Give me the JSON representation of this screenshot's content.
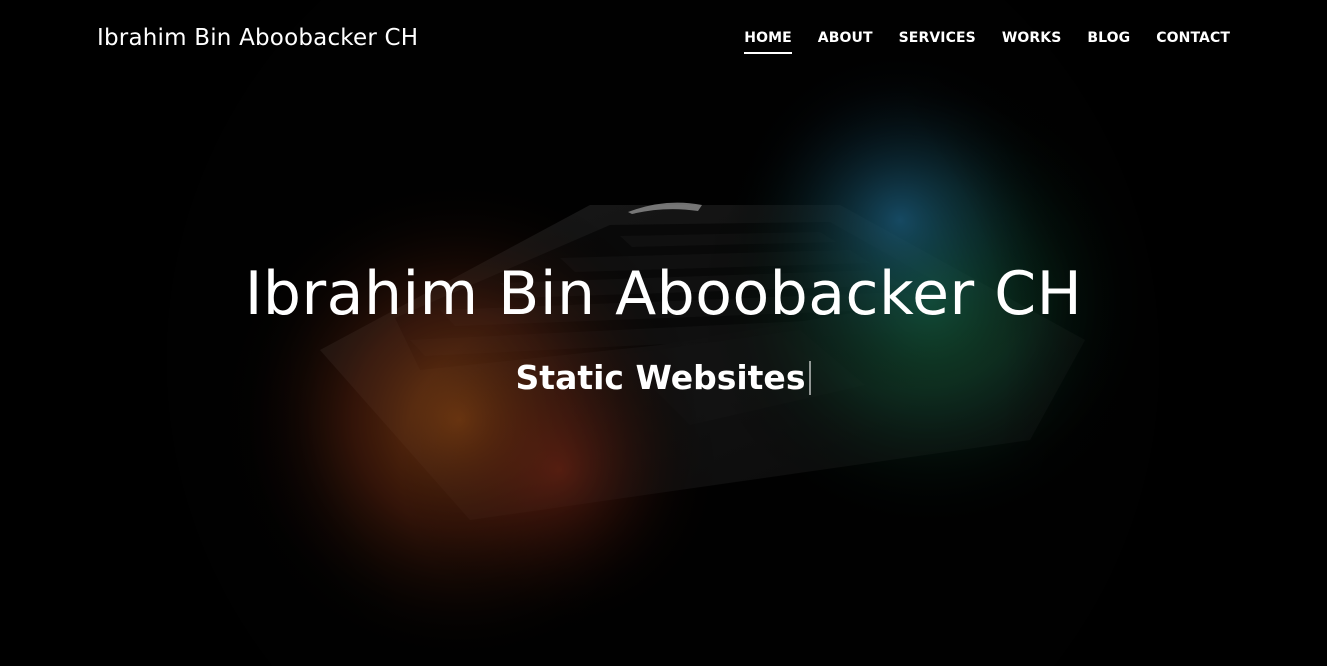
{
  "header": {
    "brand": "Ibrahim Bin Aboobacker CH"
  },
  "nav": {
    "items": [
      {
        "label": "HOME",
        "active": true
      },
      {
        "label": "ABOUT",
        "active": false
      },
      {
        "label": "SERVICES",
        "active": false
      },
      {
        "label": "WORKS",
        "active": false
      },
      {
        "label": "BLOG",
        "active": false
      },
      {
        "label": "CONTACT",
        "active": false
      }
    ]
  },
  "hero": {
    "title": "Ibrahim Bin Aboobacker CH",
    "subtitle": "Static Websites",
    "background_image": "laptop-keyboard-dark"
  },
  "colors": {
    "text": "#ffffff",
    "background": "#000000",
    "glow_orange": "#c4621a",
    "glow_green": "#1f9a55",
    "glow_blue": "#1d6fa8"
  }
}
